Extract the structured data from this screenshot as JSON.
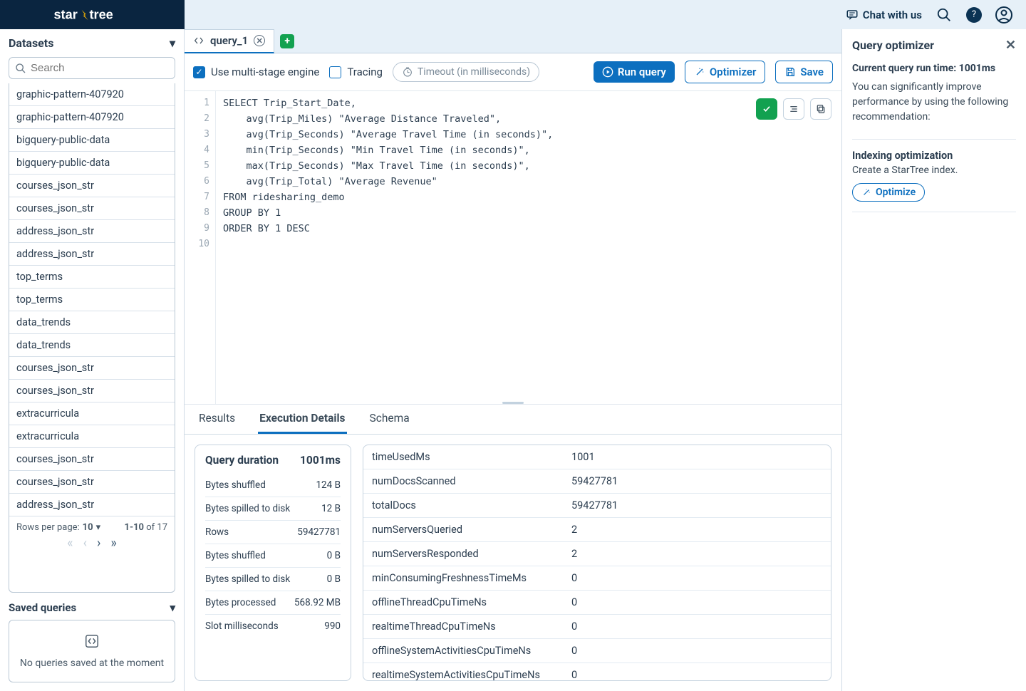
{
  "header": {
    "logo_a": "star",
    "logo_b": "tree",
    "chat": "Chat with us"
  },
  "sidebar": {
    "datasets_title": "Datasets",
    "search_placeholder": "Search",
    "items": [
      "graphic-pattern-407920",
      "graphic-pattern-407920",
      "bigquery-public-data",
      "bigquery-public-data",
      "courses_json_str",
      "courses_json_str",
      "address_json_str",
      "address_json_str",
      "top_terms",
      "top_terms",
      "data_trends",
      "data_trends",
      "courses_json_str",
      "courses_json_str",
      "extracurricula",
      "extracurricula",
      "courses_json_str",
      "courses_json_str",
      "address_json_str"
    ],
    "rows_per_page_label": "Rows per page:",
    "rows_per_page_value": "10",
    "page_range": "1-10",
    "page_of": " of 17",
    "saved_title": "Saved queries",
    "saved_empty": "No queries saved at the moment"
  },
  "tab": {
    "name": "query_1"
  },
  "toolbar": {
    "multi_stage": "Use multi-stage engine",
    "tracing": "Tracing",
    "timeout_placeholder": "Timeout (in milliseconds)",
    "run": "Run query",
    "optimizer": "Optimizer",
    "save": "Save"
  },
  "code": [
    "SELECT Trip_Start_Date,",
    "    avg(Trip_Miles) \"Average Distance Traveled\",",
    "    avg(Trip_Seconds) \"Average Travel Time (in seconds)\",",
    "    min(Trip_Seconds) \"Min Travel Time (in seconds)\",",
    "    max(Trip_Seconds) \"Max Travel Time (in seconds)\",",
    "    avg(Trip_Total) \"Average Revenue\"",
    "FROM ridesharing_demo",
    "GROUP BY 1",
    "ORDER BY 1 DESC",
    ""
  ],
  "results_tabs": {
    "results": "Results",
    "exec": "Execution Details",
    "schema": "Schema"
  },
  "duration": {
    "title": "Query duration",
    "value": "1001ms",
    "rows": [
      {
        "k": "Bytes shuffled",
        "v": "124 B"
      },
      {
        "k": "Bytes spilled to disk",
        "v": "12 B"
      },
      {
        "k": "Rows",
        "v": "59427781"
      },
      {
        "k": "Bytes shuffled",
        "v": "0 B"
      },
      {
        "k": "Bytes spilled to disk",
        "v": "0 B"
      },
      {
        "k": "Bytes processed",
        "v": "568.92 MB"
      },
      {
        "k": "Slot milliseconds",
        "v": "990"
      }
    ]
  },
  "stats": [
    {
      "k": "timeUsedMs",
      "v": "1001"
    },
    {
      "k": "numDocsScanned",
      "v": "59427781"
    },
    {
      "k": "totalDocs",
      "v": "59427781"
    },
    {
      "k": "numServersQueried",
      "v": "2"
    },
    {
      "k": "numServersResponded",
      "v": "2"
    },
    {
      "k": "minConsumingFreshnessTimeMs",
      "v": "0"
    },
    {
      "k": "offlineThreadCpuTimeNs",
      "v": "0"
    },
    {
      "k": "realtimeThreadCpuTimeNs",
      "v": "0"
    },
    {
      "k": "offlineSystemActivitiesCpuTimeNs",
      "v": "0"
    },
    {
      "k": "realtimeSystemActivitiesCpuTimeNs",
      "v": "0"
    }
  ],
  "optimizer_panel": {
    "title": "Query optimizer",
    "runtime_label": "Current query run time: 1001ms",
    "intro": "You can significantly improve performance by using the following recommendation:",
    "section_title": "Indexing optimization",
    "section_desc": "Create a StarTree index.",
    "button": "Optimize"
  }
}
